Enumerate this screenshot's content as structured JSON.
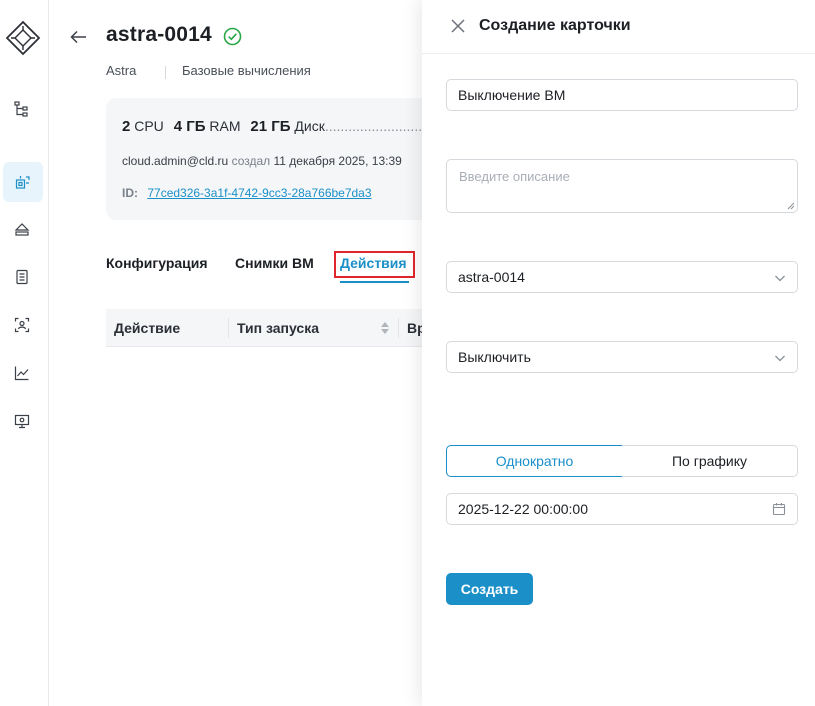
{
  "colors": {
    "accent": "#1a8fc8",
    "highlight": "#e0262b",
    "ok": "#27a745"
  },
  "sidebar": {
    "logo_icon": "diamond-grid-logo",
    "items": [
      {
        "icon": "hierarchy-icon",
        "active": false
      },
      {
        "icon": "compute-icon",
        "active": true
      },
      {
        "icon": "storage-icon",
        "active": false
      },
      {
        "icon": "list-icon",
        "active": false
      },
      {
        "icon": "scan-user-icon",
        "active": false
      },
      {
        "icon": "chart-line-icon",
        "active": false
      },
      {
        "icon": "monitor-settings-icon",
        "active": false
      }
    ]
  },
  "header": {
    "title": "astra-0014",
    "status_icon": "check-circle-icon",
    "breadcrumbs": [
      "Astra",
      "Базовые вычисления"
    ]
  },
  "vm_card": {
    "cpu_value": "2",
    "cpu_unit": "CPU",
    "ram_value": "4 ГБ",
    "ram_unit": "RAM",
    "disk_value": "21 ГБ",
    "disk_unit": "Диск",
    "owner": "cloud.admin@cld.ru",
    "created_label": "создал",
    "created_at": "11 декабря 2025, 13:39",
    "id_label": "ID:",
    "id_value": "77ced326-3a1f-4742-9cc3-28a766be7da3"
  },
  "tabs": [
    {
      "label": "Конфигурация",
      "active": false
    },
    {
      "label": "Снимки ВМ",
      "active": false
    },
    {
      "label": "Действия",
      "active": true
    }
  ],
  "table": {
    "headers": [
      "Действие",
      "Тип запуска",
      "Вр"
    ]
  },
  "drawer": {
    "title": "Создание карточки",
    "name_value": "Выключение ВМ",
    "description_placeholder": "Введите описание",
    "vm_select_value": "astra-0014",
    "action_select_value": "Выключить",
    "schedule_options": [
      "Однократно",
      "По графику"
    ],
    "schedule_selected": "Однократно",
    "datetime_value": "2025-12-22 00:00:00",
    "create_button": "Создать"
  }
}
